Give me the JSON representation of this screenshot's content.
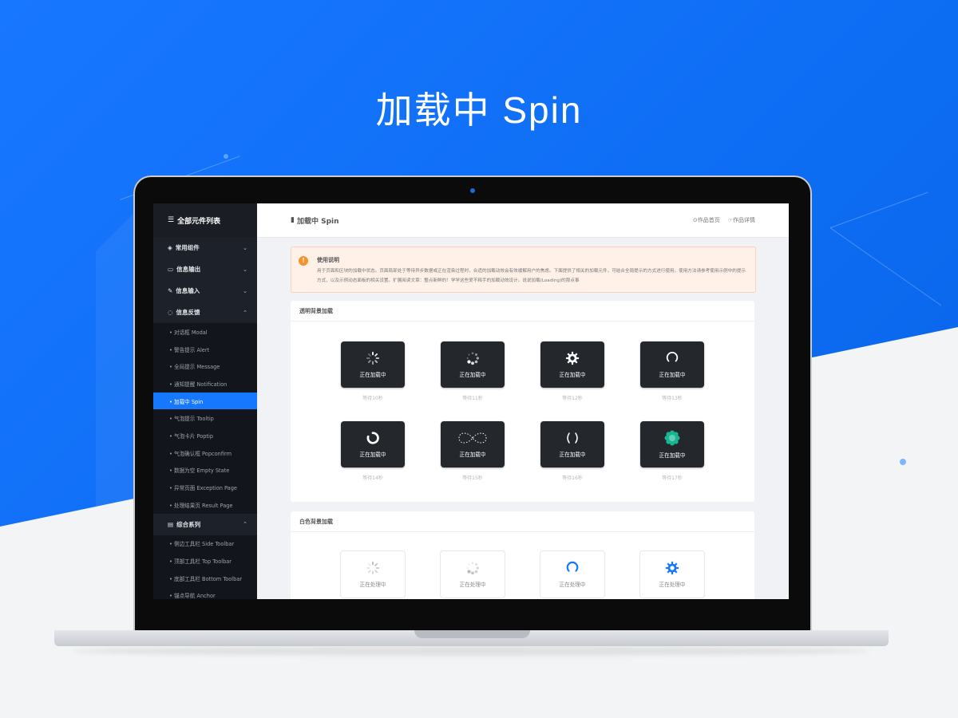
{
  "hero": {
    "title": "加载中 Spin"
  },
  "sidebar": {
    "title": "全部元件列表",
    "groups": [
      {
        "label": "常用组件",
        "icon": "cube-icon",
        "expanded": false
      },
      {
        "label": "信息输出",
        "icon": "monitor-icon",
        "expanded": false
      },
      {
        "label": "信息输入",
        "icon": "edit-icon",
        "expanded": false
      },
      {
        "label": "信息反馈",
        "icon": "comment-icon",
        "expanded": true
      },
      {
        "label": "综合系列",
        "icon": "layout-icon",
        "expanded": true
      }
    ],
    "feedback_items": [
      "• 对话框 Modal",
      "• 警告提示 Alert",
      "• 全局提示 Message",
      "• 通知提醒 Notification",
      "• 加载中 Spin",
      "• 气泡提示 Tooltip",
      "• 气泡卡片 Poptip",
      "• 气泡确认框 Popconfirm",
      "• 数据为空 Empty State",
      "• 异常页面 Exception Page",
      "• 处理结果页 Result Page"
    ],
    "active_item": "• 加载中 Spin",
    "combo_items": [
      "• 侧边工具栏 Side Toolbar",
      "• 顶部工具栏 Top Toolbar",
      "• 底部工具栏 Bottom Toolbar",
      "• 锚点导航 Anchor"
    ]
  },
  "topbar": {
    "title": "加载中 Spin",
    "links": [
      "作品首页",
      "作品详情"
    ]
  },
  "alert": {
    "title": "使用说明",
    "text": "用于页面和区块的加载中状态。页面局部处于等待异步数据或正在渲染过程时，合适的加载动效会有效缓解用户的焦虑。下面提供了相关的加载元件，可结合全局提示的方式进行使用。使用方法请参考使用示例中的提示方式，以及示例动态面板的相关设置。扩展阅读文章：整点新鲜的！学学这些爱不释手的加载动效设计。说说加载(Loading)的那点事"
  },
  "panels": {
    "transparent": {
      "title": "透明背景加载",
      "cards": [
        {
          "label": "正在加载中",
          "wait": "等待10秒",
          "icon": "spinner-lines-icon"
        },
        {
          "label": "正在加载中",
          "wait": "等待11秒",
          "icon": "spinner-dots-icon"
        },
        {
          "label": "正在加载中",
          "wait": "等待12秒",
          "icon": "gear-icon"
        },
        {
          "label": "正在加载中",
          "wait": "等待13秒",
          "icon": "arc-spinner-icon"
        },
        {
          "label": "正在加载中",
          "wait": "等待14秒",
          "icon": "ring-spinner-icon"
        },
        {
          "label": "正在加载中",
          "wait": "等待15秒",
          "icon": "infinity-icon"
        },
        {
          "label": "正在加载中",
          "wait": "等待16秒",
          "icon": "parentheses-icon"
        },
        {
          "label": "正在加载中",
          "wait": "等待17秒",
          "icon": "flower-spinner-icon"
        }
      ]
    },
    "white": {
      "title": "白色背景加载",
      "cards": [
        {
          "label": "正在处理中",
          "icon": "spinner-lines-icon"
        },
        {
          "label": "正在处理中",
          "icon": "spinner-dots-icon"
        },
        {
          "label": "正在处理中",
          "icon": "arc-spinner-icon"
        },
        {
          "label": "正在处理中",
          "icon": "gear-icon"
        }
      ]
    }
  },
  "colors": {
    "accent": "#1677ff",
    "background": "#1877ff",
    "spinner_green": "#1ab394"
  }
}
